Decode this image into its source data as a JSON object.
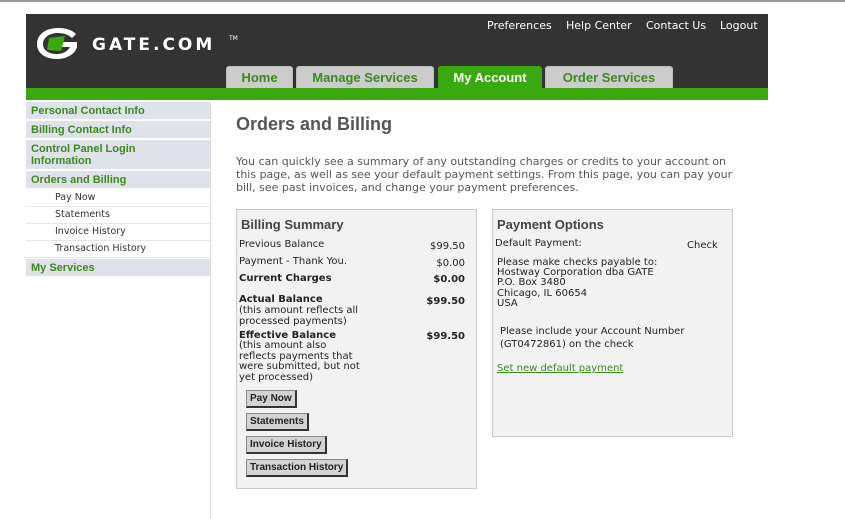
{
  "header": {
    "logo_text": "GATE.COM",
    "logo_tm": "TM",
    "utility_links": [
      "Preferences",
      "Help Center",
      "Contact Us",
      "Logout"
    ],
    "tabs": [
      "Home",
      "Manage Services",
      "My Account",
      "Order Services"
    ],
    "active_tab": "My Account",
    "colors": {
      "brand_green": "#39a90f",
      "header_bg": "#333333",
      "link_green": "#3a8a1c"
    }
  },
  "sidebar": {
    "personal_contact": "Personal Contact Info",
    "billing_contact": "Billing Contact Info",
    "control_panel_line1": "Control Panel Login",
    "control_panel_line2": "Information",
    "orders_billing": "Orders and Billing",
    "sub_items": [
      "Pay Now",
      "Statements",
      "Invoice History",
      "Transaction History"
    ],
    "my_services": "My Services"
  },
  "main": {
    "title": "Orders and Billing",
    "intro_lines": [
      "You can quickly see a summary of any outstanding charges or credits to your account on",
      "this page, as well as see your default payment settings. From this page, you can pay your",
      "bill, see past invoices, and change your payment preferences."
    ]
  },
  "billing_summary": {
    "title": "Billing Summary",
    "previous_balance_label": "Previous Balance",
    "previous_balance": "$99.50",
    "payment_label": "Payment - Thank You.",
    "payment": "$0.00",
    "current_charges_label": "Current Charges",
    "current_charges": "$0.00",
    "actual_balance_label": "Actual Balance",
    "actual_balance": "$99.50",
    "actual_note_lines": [
      "(this amount reflects all",
      "processed payments)"
    ],
    "effective_balance_label": "Effective Balance",
    "effective_balance": "$99.50",
    "effective_note_lines": [
      "(this amount also",
      "reflects payments that",
      "were submitted, but not",
      "yet processed)"
    ],
    "buttons": [
      "Pay Now",
      "Statements",
      "Invoice History",
      "Transaction History"
    ]
  },
  "payment_options": {
    "title": "Payment Options",
    "default_label": "Default Payment:",
    "default_value": "Check",
    "address_lines": [
      "Please make checks payable to:",
      "Hostway Corporation dba GATE",
      "P.O. Box 3480",
      "Chicago, IL 60654",
      "USA"
    ],
    "account_note_lines": [
      "Please include your Account Number",
      "(GT0472861) on the check"
    ],
    "set_default_link": "Set new default payment"
  }
}
